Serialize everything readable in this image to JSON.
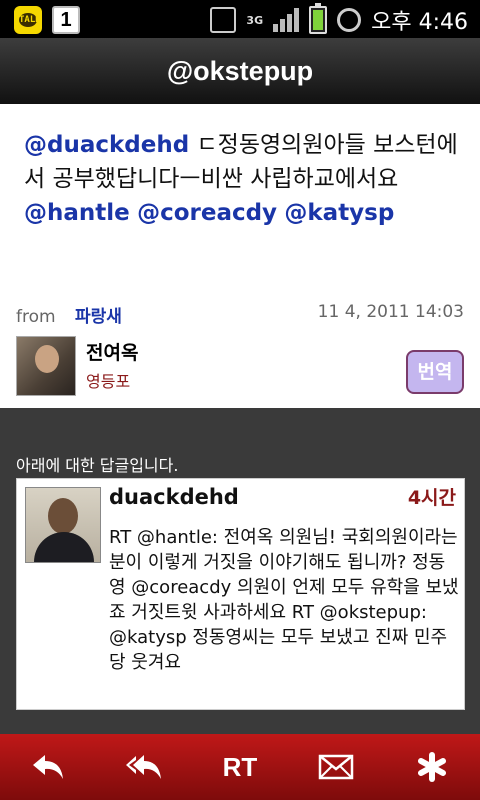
{
  "status_bar": {
    "calendar_day": "1",
    "network": "3G",
    "time": "오후 4:46",
    "icons": [
      "kakaotalk-icon",
      "calendar-icon",
      "vibrate-icon",
      "signal-icon",
      "battery-icon",
      "alarm-icon"
    ]
  },
  "header": {
    "title": "@okstepup"
  },
  "tweet": {
    "segments": [
      {
        "text": "@duackdehd",
        "mention": true
      },
      {
        "text": " ㄷ정동영의원아들 보스턴에서 공부했답니다ㅡ비싼 사립하교에서요 ",
        "mention": false
      },
      {
        "text": "@hantle",
        "mention": true
      },
      {
        "text": " ",
        "mention": false
      },
      {
        "text": "@coreacdy",
        "mention": true
      },
      {
        "text": " ",
        "mention": false
      },
      {
        "text": "@katysp",
        "mention": true
      }
    ],
    "from_label": "from",
    "source": "파랑새",
    "date": "11 4, 2011 14:03",
    "author_name": "전여옥",
    "author_location": "영등포",
    "translate_label": "번역"
  },
  "reply": {
    "label": "아래에 대한 답글입니다.",
    "user": "duackdehd",
    "time": "4시간",
    "text": "RT @hantle: 전여옥 의원님! 국회의원이라는 분이 이렇게 거짓을 이야기해도 됩니까? 정동영 @coreacdy 의원이 언제 모두 유학을 보냈죠 거짓트윗 사과하세요 RT @okstepup: @katysp 정동영씨는 모두 보냈고 진짜 민주당 웃겨요"
  },
  "toolbar": {
    "rt_label": "RT",
    "icons": [
      "reply-icon",
      "reply-all-icon",
      "retweet-icon",
      "message-icon",
      "favorite-icon"
    ]
  },
  "colors": {
    "mention": "#1a35a8",
    "toolbar": "#b51313",
    "accent_red": "#8b1a1a",
    "translate_button": "#c4b6ef"
  }
}
